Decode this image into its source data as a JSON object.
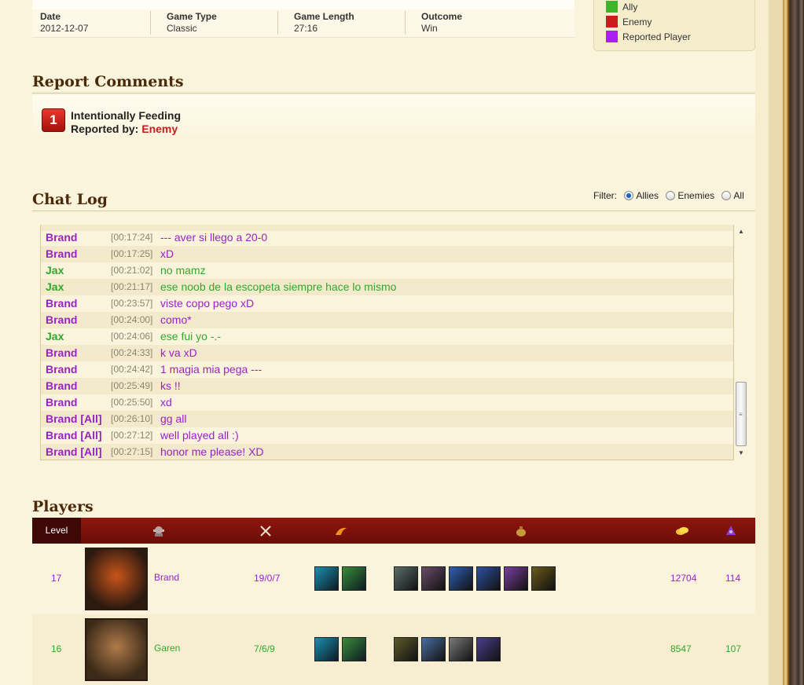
{
  "summary": {
    "date_label": "Date",
    "date": "2012-12-07",
    "type_label": "Game Type",
    "type": "Classic",
    "length_label": "Game Length",
    "length": "27:16",
    "outcome_label": "Outcome",
    "outcome": "Win"
  },
  "legend": {
    "ally": "Ally",
    "enemy": "Enemy",
    "reported": "Reported Player",
    "colors": {
      "ally": "#3cb52a",
      "enemy": "#cc1b1b",
      "reported": "#a81ef5"
    }
  },
  "report": {
    "title": "Report Comments",
    "count": "1",
    "reason": "Intentionally Feeding",
    "reported_by_label": "Reported by:",
    "reported_by": "Enemy"
  },
  "chat": {
    "title": "Chat Log",
    "filter_label": "Filter:",
    "filters": [
      "Allies",
      "Enemies",
      "All"
    ],
    "selected_filter": "Allies",
    "rows": [
      {
        "name": "Brand",
        "time": "[00:17:24]",
        "msg": "--- aver si llego a 20-0",
        "team": "reported"
      },
      {
        "name": "Brand",
        "time": "[00:17:25]",
        "msg": "xD",
        "team": "reported"
      },
      {
        "name": "Jax",
        "time": "[00:21:02]",
        "msg": "no mamz",
        "team": "ally"
      },
      {
        "name": "Jax",
        "time": "[00:21:17]",
        "msg": "ese noob de la escopeta siempre hace lo mismo",
        "team": "ally"
      },
      {
        "name": "Brand",
        "time": "[00:23:57]",
        "msg": "viste copo pego xD",
        "team": "reported"
      },
      {
        "name": "Brand",
        "time": "[00:24:00]",
        "msg": "como*",
        "team": "reported"
      },
      {
        "name": "Jax",
        "time": "[00:24:06]",
        "msg": "ese fui yo -.-",
        "team": "ally"
      },
      {
        "name": "Brand",
        "time": "[00:24:33]",
        "msg": "k va xD",
        "team": "reported"
      },
      {
        "name": "Brand",
        "time": "[00:24:42]",
        "msg": "1 magia mia pega ---",
        "team": "reported"
      },
      {
        "name": "Brand",
        "time": "[00:25:49]",
        "msg": "ks !!",
        "team": "reported"
      },
      {
        "name": "Brand",
        "time": "[00:25:50]",
        "msg": "xd",
        "team": "reported"
      },
      {
        "name": "Brand [All]",
        "time": "[00:26:10]",
        "msg": "gg all",
        "team": "reported"
      },
      {
        "name": "Brand [All]",
        "time": "[00:27:12]",
        "msg": "well played all :)",
        "team": "reported"
      },
      {
        "name": "Brand [All]",
        "time": "[00:27:15]",
        "msg": "honor me please! XD",
        "team": "reported"
      }
    ]
  },
  "players": {
    "title": "Players",
    "level_header": "Level",
    "header_icons": [
      "champion-icon",
      "kda-swords-icon",
      "spells-flame-icon",
      "items-bag-icon",
      "gold-coins-icon",
      "minions-icon"
    ],
    "rows": [
      {
        "level": "17",
        "champion": "Brand",
        "kda": "19/0/7",
        "gold": "12704",
        "cs": "114",
        "team": "reported",
        "portrait_colors": [
          "#2b1a10",
          "#c9541a"
        ],
        "spells": [
          "#1b8fb0",
          "#3a8c3a"
        ],
        "items": [
          "#5a6e6a",
          "#6b4d6a",
          "#2f5fb3",
          "#2e4fa1",
          "#7a3fa0",
          "#6a5a1a"
        ]
      },
      {
        "level": "16",
        "champion": "Garen",
        "kda": "7/6/9",
        "gold": "8547",
        "cs": "107",
        "team": "ally",
        "portrait_colors": [
          "#3b2a18",
          "#b07a4a"
        ],
        "spells": [
          "#1b8fb0",
          "#3a8c3a"
        ],
        "items": [
          "#5e5a2a",
          "#4a6fa0",
          "#7a7a7a",
          "#4a3f8a"
        ]
      }
    ]
  }
}
